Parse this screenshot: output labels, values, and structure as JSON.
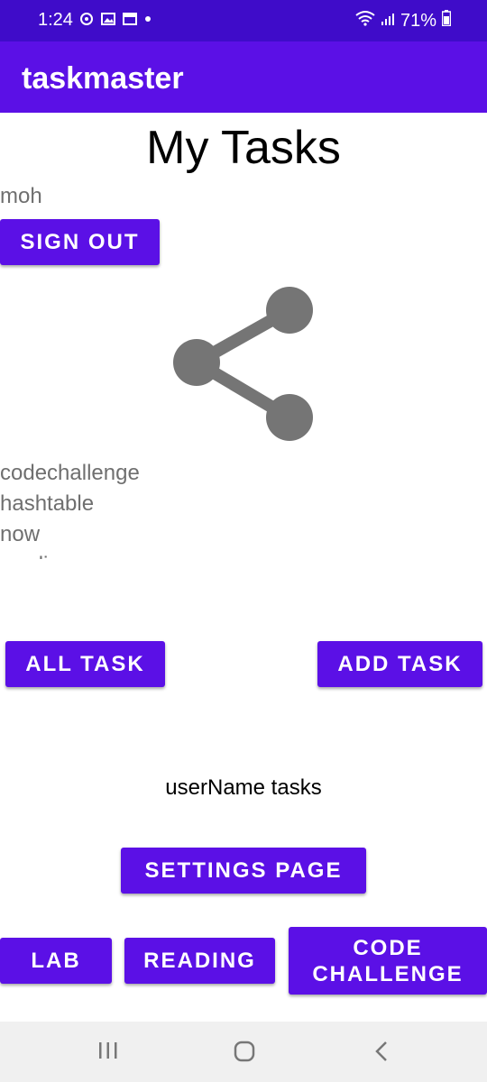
{
  "status_bar": {
    "time": "1:24",
    "battery": "71%"
  },
  "app_bar": {
    "title": "taskmaster"
  },
  "page": {
    "title": "My Tasks",
    "username": "moh",
    "sign_out_label": "SIGN OUT",
    "tasks": [
      "codechallenge",
      "hashtable",
      "now",
      "reading"
    ],
    "all_task_label": "ALL TASK",
    "add_task_label": "ADD TASK",
    "user_tasks_label": "userName  tasks",
    "settings_label": "SETTINGS PAGE",
    "lab_label": "LAB",
    "reading_label": "READING",
    "code_challenge_label": "CODE CHALLENGE"
  },
  "icons": {
    "share": "share-icon",
    "recents": "recents-icon",
    "home": "home-icon",
    "back": "back-icon"
  },
  "colors": {
    "status_bar": "#3f0cc9",
    "primary": "#5b10e6",
    "icon_gray": "#757575",
    "nav_bar": "#f0f0f0"
  }
}
